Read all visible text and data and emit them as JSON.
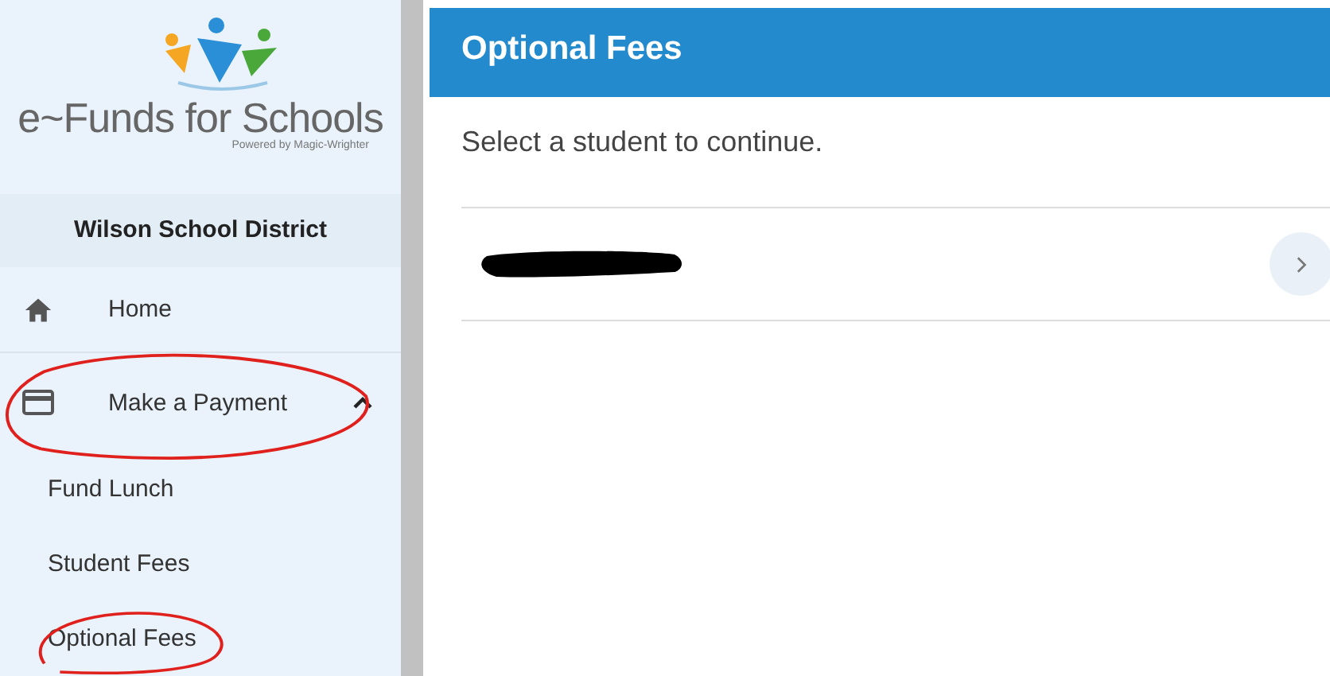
{
  "logo": {
    "title": "e~Funds for Schools",
    "tagline": "Powered by Magic-Wrighter"
  },
  "district": "Wilson School District",
  "nav": [
    {
      "kind": "home",
      "label": "Home"
    },
    {
      "kind": "group",
      "label": "Make a Payment",
      "expanded": true,
      "circled": true,
      "children": [
        {
          "label": "Fund Lunch",
          "circled": false
        },
        {
          "label": "Student Fees",
          "circled": false
        },
        {
          "label": "Optional Fees",
          "circled": true
        }
      ]
    }
  ],
  "page": {
    "title": "Optional Fees",
    "instruction": "Select a student to continue.",
    "students": [
      {
        "redacted": true
      }
    ]
  }
}
